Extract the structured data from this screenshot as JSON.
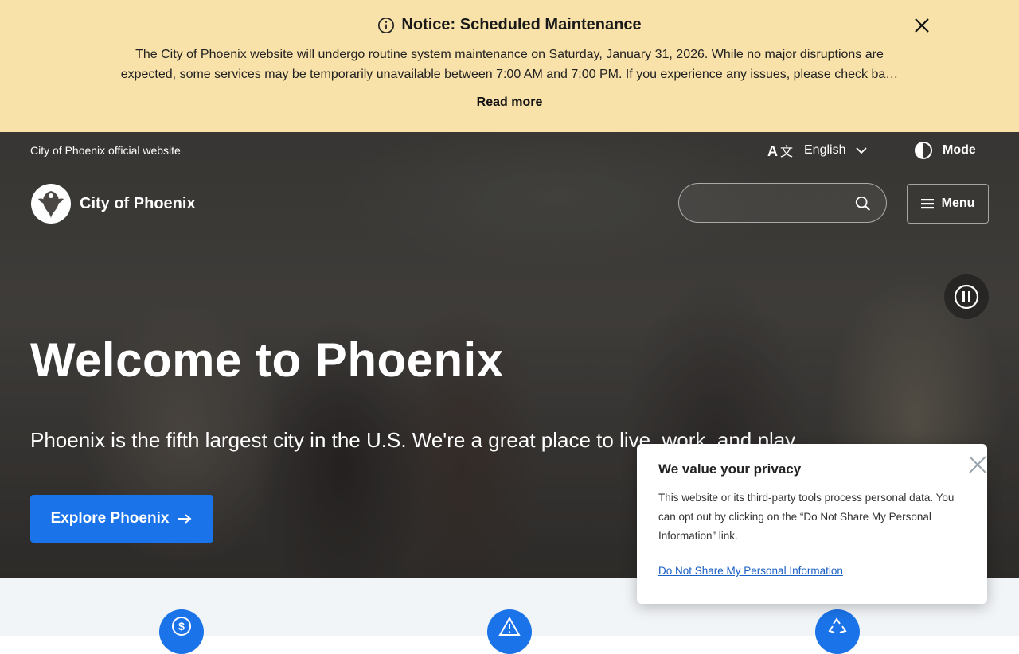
{
  "notice": {
    "title": "Notice: Scheduled Maintenance",
    "body": "The City of Phoenix website will undergo routine system maintenance on Saturday, January 31, 2026. While no major disruptions are expected, some services may be temporarily unavailable between 7:00 AM and 7:00 PM. If you experience any issues, please check back later.",
    "read_more": "Read more"
  },
  "header": {
    "official_text": "City of Phoenix official website",
    "language": "English",
    "mode_label": "Mode",
    "logo_text": "City of Phoenix",
    "menu_label": "Menu"
  },
  "search": {
    "placeholder": "",
    "value": ""
  },
  "hero": {
    "title": "Welcome to Phoenix",
    "subtitle": "Phoenix is the fifth largest city in the U.S. We're a great place to live, work, and play.",
    "cta_label": "Explore Phoenix"
  },
  "privacy": {
    "title": "We value your privacy",
    "text": "This website or its third-party tools process personal data. You can opt out by clicking on the “Do Not Share My Personal Information” link.",
    "link": "Do Not Share My Personal Information"
  },
  "quick_links": [
    {
      "icon": "dollar-icon"
    },
    {
      "icon": "warning-icon"
    },
    {
      "icon": "recycle-icon"
    }
  ],
  "colors": {
    "notice_bg": "#f8e2a9",
    "accent": "#1a73e8",
    "strip_bg": "#f2f5f8"
  }
}
